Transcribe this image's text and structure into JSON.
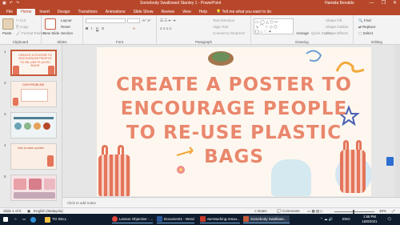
{
  "window": {
    "title": "Somebody Swallowed Stanley 1 - PowerPoint",
    "user": "Hamida Bevaldo",
    "controls": [
      "—",
      "❐",
      "✕"
    ]
  },
  "tabs": [
    "File",
    "Home",
    "Insert",
    "Design",
    "Transitions",
    "Animations",
    "Slide Show",
    "Review",
    "View",
    "Help"
  ],
  "tell_me": "Tell me what you want to do",
  "ribbon": {
    "clipboard": {
      "paste": "Paste",
      "cut": "Cut",
      "copy": "Copy",
      "format_painter": "Format Painter",
      "label": "Clipboard"
    },
    "slides": {
      "new_slide": "New Slide",
      "layout": "Layout",
      "reset": "Reset",
      "section": "Section",
      "label": "Slides"
    },
    "font": {
      "label": "Font"
    },
    "paragraph": {
      "text_direction": "Text Direction",
      "align_text": "Align Text",
      "smartart": "Convert to SmartArt",
      "label": "Paragraph"
    },
    "drawing": {
      "arrange": "Arrange",
      "quick_styles": "Quick Styles",
      "shape_fill": "Shape Fill",
      "shape_outline": "Shape Outline",
      "shape_effects": "Shape Effects",
      "label": "Drawing"
    },
    "editing": {
      "find": "Find",
      "replace": "Replace",
      "select": "Select",
      "label": "Editing"
    }
  },
  "thumbnails": [
    {
      "num": "1",
      "text": "CREATE A POSTER TO ENCOURAGE PEOPLE TO RE-USE PLASTIC BAGS"
    },
    {
      "num": "2",
      "text": "OUR PROBLEM"
    },
    {
      "num": "3",
      "text": ""
    },
    {
      "num": "4",
      "text": "How to make a poster"
    },
    {
      "num": "5",
      "text": ""
    }
  ],
  "slide": {
    "title_lines": [
      "CREATE A POSTER TO",
      "ENCOURAGE PEOPLE",
      "TO RE-USE PLASTIC",
      "BAGS"
    ]
  },
  "notes_placeholder": "Click to add notes",
  "status": {
    "slide_of": "Slide 1 of 5",
    "language": "English (Malaysia)",
    "notes": "Notes",
    "comments": "Comments",
    "zoom": "46%"
  },
  "taskbar": {
    "items": [
      "TO SELL",
      "Lesson Objective - ...",
      "Document1 - Word",
      "ow-teaching-resou...",
      "Somebody Swallowe..."
    ],
    "lang": "ENG",
    "time": "1:58 PM",
    "date": "16/8/2021"
  },
  "colors": {
    "accent": "#b7472a",
    "title": "#e9876c",
    "taskbar": "#0f1c2e"
  }
}
